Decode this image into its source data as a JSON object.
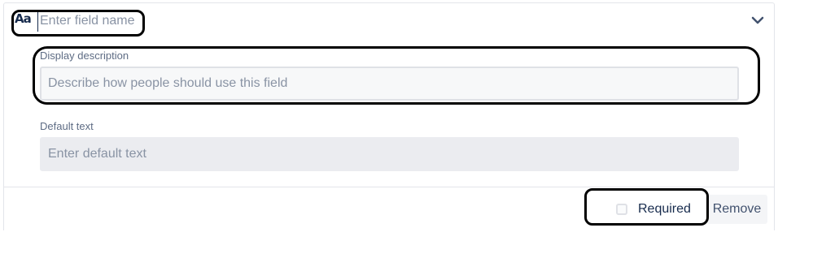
{
  "field": {
    "type_icon": "Aa",
    "name_placeholder": "Enter field name",
    "name_value": "",
    "collapse_icon": "chevron-down-icon"
  },
  "description": {
    "label": "Display description",
    "placeholder": "Describe how people should use this field",
    "value": ""
  },
  "default_text": {
    "label": "Default text",
    "placeholder": "Enter default text",
    "value": ""
  },
  "footer": {
    "required_label": "Required",
    "required_checked": false,
    "remove_label": "Remove"
  }
}
